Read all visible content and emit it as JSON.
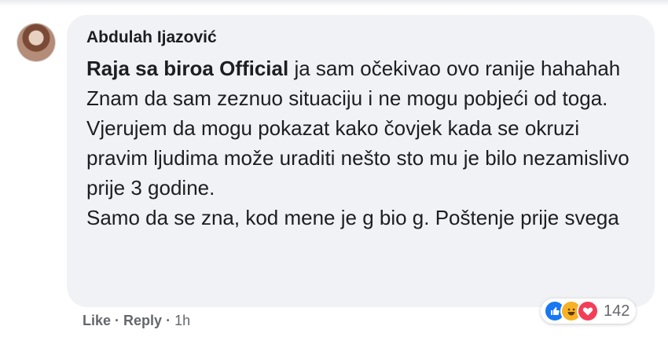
{
  "comment": {
    "author": "Abdulah Ijazović",
    "mention": "Raja sa biroa Official",
    "text_after_mention": " ja sam očekivao ovo ranije hahahah",
    "paragraphs": [
      "Znam da sam zeznuo situaciju i ne mogu pobjeći od toga. Vjerujem da mogu pokazat kako čovjek kada se okruzi pravim ljudima može uraditi nešto sto mu je bilo nezamislivo prije 3 godine.",
      "Samo da se zna, kod mene je g bio g. Poštenje prije svega"
    ]
  },
  "reactions": {
    "icons": [
      "like-icon",
      "haha-icon",
      "love-icon"
    ],
    "count": "142",
    "colors": {
      "like": "#1877f2",
      "haha": "#f7b125",
      "love": "#f33e58"
    }
  },
  "actions": {
    "like_label": "Like",
    "reply_label": "Reply",
    "separator": "·",
    "time": "1h"
  }
}
